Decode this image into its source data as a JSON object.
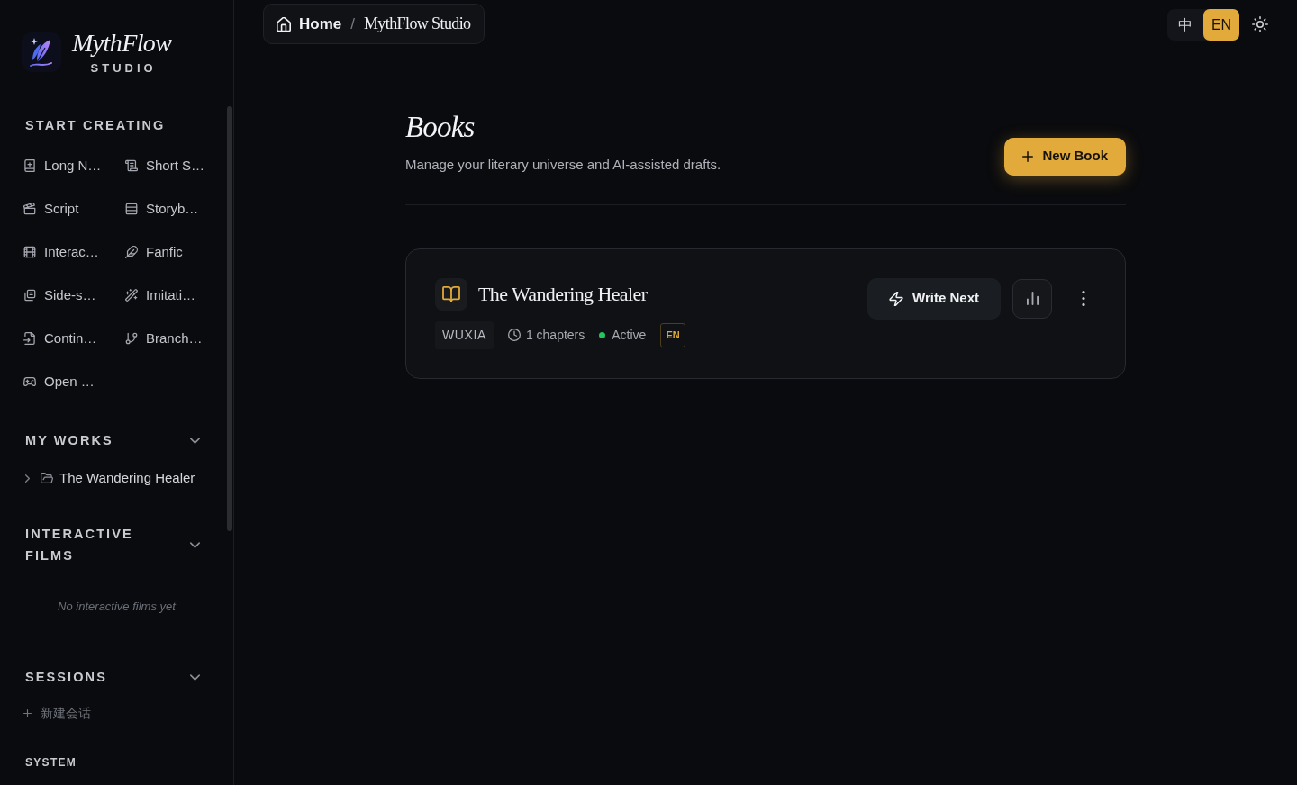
{
  "brand": {
    "name": "MythFlow",
    "subtitle": "STUDIO"
  },
  "sidebar": {
    "start_creating": {
      "title": "START CREATING",
      "items": [
        "Long N…",
        "Short S…",
        "Script",
        "Storyb…",
        "Interac…",
        "Fanfic",
        "Side-s…",
        "Imitati…",
        "Contin…",
        "Branch…",
        "Open …"
      ]
    },
    "my_works": {
      "title": "MY WORKS",
      "expanded": true,
      "items": [
        {
          "label": "The Wandering Healer",
          "expanded": false
        }
      ]
    },
    "interactive_films": {
      "title": "INTERACTIVE FILMS",
      "expanded": true,
      "empty_text": "No interactive films yet"
    },
    "sessions": {
      "title": "SESSIONS",
      "expanded": true,
      "new_session": "新建会话"
    },
    "system": {
      "title": "SYSTEM"
    }
  },
  "breadcrumb": {
    "items": [
      {
        "label": "Home"
      },
      {
        "label": "MythFlow Studio"
      }
    ],
    "separator": "/"
  },
  "language_toggle": [
    {
      "label": "中",
      "selected": false
    },
    {
      "label": "EN",
      "selected": true
    }
  ],
  "page": {
    "title": "Books",
    "subtitle": "Manage your literary universe and AI-assisted drafts.",
    "new_button": "New Book"
  },
  "books": [
    {
      "title": "The Wandering Healer",
      "genre": "WUXIA",
      "chapters": "1 chapters",
      "status": {
        "label": "Active",
        "color": "#22c55e"
      },
      "language": "EN",
      "write_button": "Write Next"
    }
  ]
}
